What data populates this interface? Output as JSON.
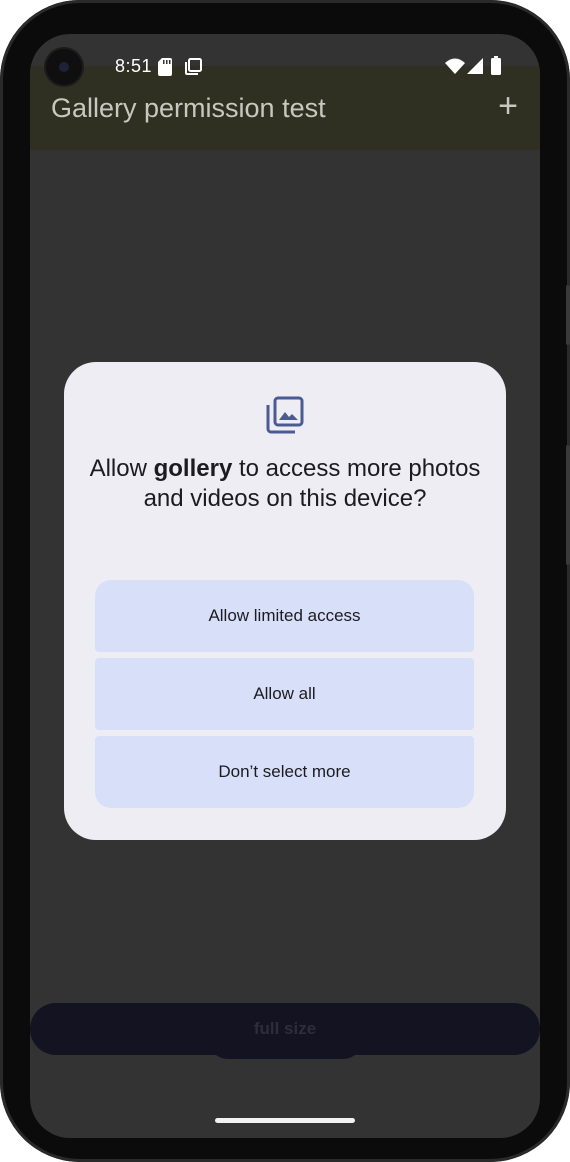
{
  "status_bar": {
    "time": "8:51",
    "icons": [
      "sd-card-icon",
      "screenshot-icon",
      "wifi-icon",
      "signal-icon",
      "battery-icon"
    ]
  },
  "app_bar": {
    "title": "Gallery permission test",
    "add_label": "+"
  },
  "dialog": {
    "icon": "photo-library-icon",
    "title_prefix": "Allow ",
    "app_name": "gollery",
    "title_suffix": " to access more photos and videos on this device?",
    "options": [
      {
        "label": "Allow limited access"
      },
      {
        "label": "Allow all"
      },
      {
        "label": "Don’t select more"
      }
    ]
  },
  "bottom_button": {
    "label": "full size"
  },
  "colors": {
    "dialog_bg": "#eeedf3",
    "option_bg": "#d8dff8",
    "accent_icon": "#4a5b92",
    "app_bar": "#2f3022",
    "scrim_bg": "#333333"
  }
}
